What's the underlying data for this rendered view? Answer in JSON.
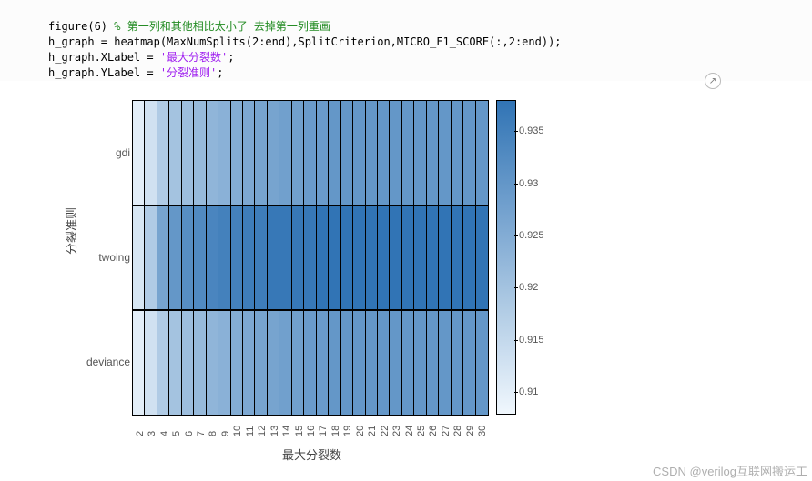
{
  "code": {
    "line1a": "figure(6) ",
    "line1b": "% 第一列和其他相比太小了 去掉第一列重画",
    "line2": "h_graph = heatmap(MaxNumSplits(2:end),SplitCriterion,MICRO_F1_SCORE(:,2:end));",
    "line3a": "h_graph.XLabel = ",
    "line3b": "'最大分裂数'",
    "line3c": ";",
    "line4a": "h_graph.YLabel = ",
    "line4b": "'分裂准则'",
    "line4c": ";"
  },
  "chart_data": {
    "type": "heatmap",
    "xlabel": "最大分裂数",
    "ylabel": "分裂准则",
    "x_categories": [
      "2",
      "3",
      "4",
      "5",
      "6",
      "7",
      "8",
      "9",
      "10",
      "11",
      "12",
      "13",
      "14",
      "15",
      "16",
      "17",
      "18",
      "19",
      "20",
      "21",
      "22",
      "23",
      "24",
      "25",
      "26",
      "27",
      "28",
      "29",
      "30"
    ],
    "y_categories": [
      "gdi",
      "twoing",
      "deviance"
    ],
    "colorbar_ticks": [
      "0.91",
      "0.915",
      "0.92",
      "0.925",
      "0.93",
      "0.935"
    ],
    "cmin": 0.908,
    "cmax": 0.938,
    "series": [
      {
        "name": "gdi",
        "values": [
          0.91,
          0.913,
          0.918,
          0.92,
          0.921,
          0.922,
          0.923,
          0.924,
          0.925,
          0.926,
          0.927,
          0.927,
          0.928,
          0.928,
          0.929,
          0.929,
          0.93,
          0.93,
          0.93,
          0.93,
          0.93,
          0.93,
          0.93,
          0.93,
          0.93,
          0.93,
          0.93,
          0.93,
          0.93
        ]
      },
      {
        "name": "twoing",
        "values": [
          0.912,
          0.918,
          0.927,
          0.93,
          0.932,
          0.933,
          0.934,
          0.935,
          0.935,
          0.936,
          0.936,
          0.937,
          0.937,
          0.937,
          0.937,
          0.938,
          0.938,
          0.938,
          0.938,
          0.938,
          0.938,
          0.938,
          0.938,
          0.938,
          0.938,
          0.938,
          0.938,
          0.938,
          0.938
        ]
      },
      {
        "name": "deviance",
        "values": [
          0.91,
          0.913,
          0.918,
          0.92,
          0.921,
          0.922,
          0.923,
          0.924,
          0.925,
          0.926,
          0.927,
          0.927,
          0.928,
          0.928,
          0.929,
          0.929,
          0.93,
          0.93,
          0.93,
          0.93,
          0.93,
          0.93,
          0.93,
          0.93,
          0.93,
          0.93,
          0.93,
          0.93,
          0.93
        ]
      }
    ]
  },
  "watermark": "CSDN @verilog互联网搬运工",
  "expand_icon_glyph": "↗"
}
